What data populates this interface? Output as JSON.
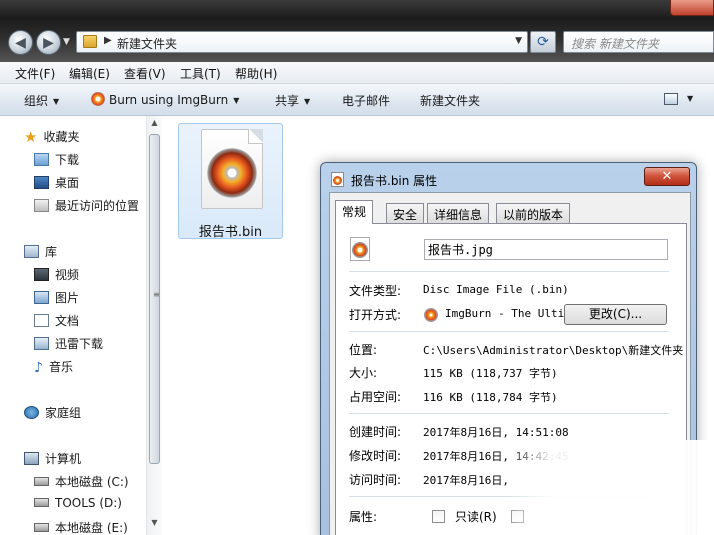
{
  "window": {
    "address": "新建文件夹",
    "search_placeholder": "搜索 新建文件夹",
    "back_symbol": "◀",
    "forward_symbol": "▶",
    "refresh_symbol": "⟳"
  },
  "menu": [
    "文件(F)",
    "编辑(E)",
    "查看(V)",
    "工具(T)",
    "帮助(H)"
  ],
  "toolbar": {
    "organize": "组织",
    "burn": "Burn using ImgBurn",
    "share": "共享",
    "email": "电子邮件",
    "new_folder": "新建文件夹"
  },
  "nav": {
    "favorites": "收藏夹",
    "downloads": "下载",
    "desktop": "桌面",
    "recent": "最近访问的位置",
    "libraries": "库",
    "videos": "视频",
    "pictures": "图片",
    "documents": "文档",
    "xunlei": "迅雷下载",
    "music": "音乐",
    "homegroup": "家庭组",
    "computer": "计算机",
    "drive_c": "本地磁盘 (C:)",
    "drive_d": "TOOLS (D:)",
    "drive_e": "本地磁盘 (E:)"
  },
  "file": {
    "name": "报告书.bin"
  },
  "dialog": {
    "title": "报告书.bin 属性",
    "close_symbol": "✕",
    "tabs": [
      "常规",
      "安全",
      "详细信息",
      "以前的版本"
    ],
    "name_value": "报告书.jpg",
    "type_label": "文件类型:",
    "type_value": "Disc Image File (.bin)",
    "openwith_label": "打开方式:",
    "openwith_value": "ImgBurn - The Ultim",
    "change_button": "更改(C)...",
    "location_label": "位置:",
    "location_value": "C:\\Users\\Administrator\\Desktop\\新建文件夹",
    "size_label": "大小:",
    "size_value": "115 KB (118,737 字节)",
    "disk_label": "占用空间:",
    "disk_value": "116 KB (118,784 字节)",
    "created_label": "创建时间:",
    "created_value": "2017年8月16日, 14:51:08",
    "modified_label": "修改时间:",
    "modified_value": "2017年8月16日, 14:42:45",
    "accessed_label": "访问时间:",
    "accessed_value": "2017年8月16日,",
    "attributes_label": "属性:",
    "readonly_label": "只读(R)"
  }
}
